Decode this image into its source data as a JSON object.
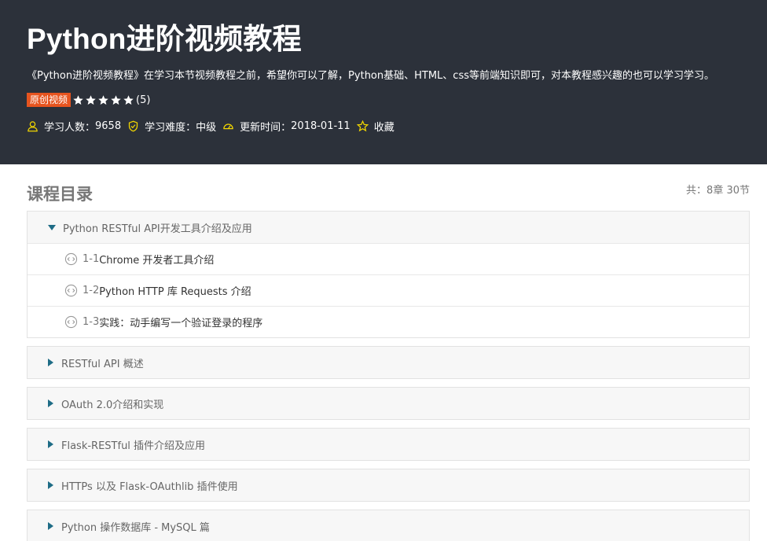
{
  "course": {
    "title": "Python进阶视频教程",
    "description": "《Python进阶视频教程》在学习本节视频教程之前，希望你可以了解，Python基础、HTML、css等前端知识即可，对本教程感兴趣的也可以学习学习。",
    "badge": "原创视频",
    "rating": 5,
    "rating_count": "(5)",
    "learners_label": "学习人数：",
    "learners_value": "9658",
    "difficulty_label": "学习难度：",
    "difficulty_value": "中级",
    "updated_label": "更新时间：",
    "updated_value": "2018-01-11",
    "favorite_label": "收藏"
  },
  "catalog": {
    "title": "课程目录",
    "count_label": "共：8章 30节",
    "chapters": [
      {
        "title": "Python RESTful API开发工具介绍及应用",
        "expanded": true,
        "lessons": [
          {
            "num": "1-1",
            "title": "Chrome 开发者工具介绍"
          },
          {
            "num": "1-2",
            "title": "Python HTTP 库 Requests 介绍"
          },
          {
            "num": "1-3",
            "title": "实践：动手编写一个验证登录的程序"
          }
        ]
      },
      {
        "title": "RESTful API 概述",
        "expanded": false
      },
      {
        "title": "OAuth 2.0介绍和实现",
        "expanded": false
      },
      {
        "title": "Flask-RESTful 插件介绍及应用",
        "expanded": false
      },
      {
        "title": "HTTPs 以及 Flask-OAuthlib 插件使用",
        "expanded": false
      },
      {
        "title": "Python 操作数据库 - MySQL 篇",
        "expanded": false
      }
    ]
  },
  "icons": {
    "star": "star-icon",
    "learners": "user-icon",
    "difficulty": "shield-check-icon",
    "updated": "gauge-icon",
    "favorite": "star-outline-icon",
    "lesson": "video-play-icon"
  },
  "colors": {
    "hero_bg": "#2c313a",
    "badge": "#e6541f",
    "icon_accent": "#f2d600",
    "triangle": "#1e6c86"
  }
}
